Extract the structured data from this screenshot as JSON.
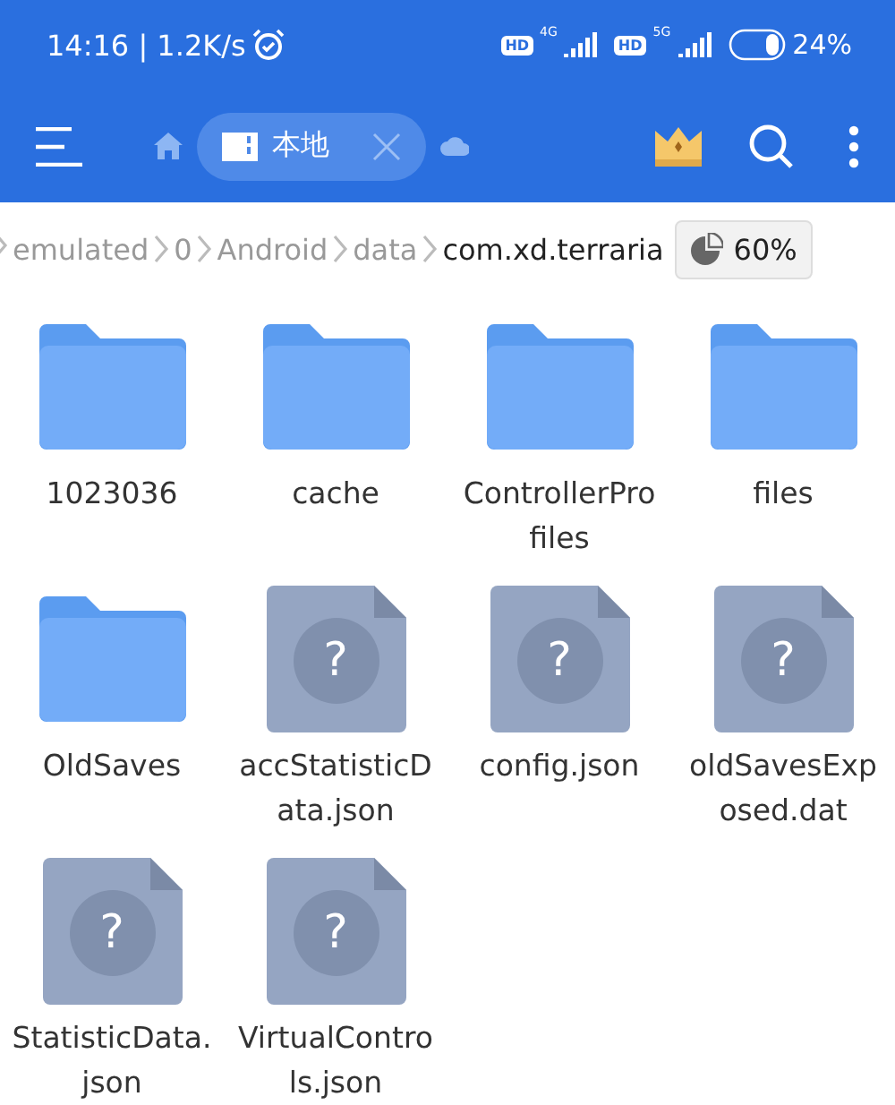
{
  "status_bar": {
    "time": "14:16 | 1.2K/s",
    "sims": [
      {
        "badge": "HD",
        "network": "4G"
      },
      {
        "badge": "HD",
        "network": "5G"
      }
    ],
    "battery": "24%"
  },
  "toolbar": {
    "tabs": [
      {
        "label": "本地",
        "selected": true
      }
    ]
  },
  "breadcrumb": {
    "items": [
      {
        "label": "emulated",
        "current": false
      },
      {
        "label": "0",
        "current": false
      },
      {
        "label": "Android",
        "current": false
      },
      {
        "label": "data",
        "current": false
      },
      {
        "label": "com.xd.terraria",
        "current": true
      }
    ],
    "storage": "60%"
  },
  "files": [
    {
      "name": "1023036",
      "kind": "folder"
    },
    {
      "name": "cache",
      "kind": "folder"
    },
    {
      "name": "ControllerProfiles",
      "kind": "folder"
    },
    {
      "name": "files",
      "kind": "folder"
    },
    {
      "name": "OldSaves",
      "kind": "folder"
    },
    {
      "name": "accStatisticData.json",
      "kind": "unknown",
      "glyph": "?"
    },
    {
      "name": "config.json",
      "kind": "unknown",
      "glyph": "?"
    },
    {
      "name": "oldSavesExposed.dat",
      "kind": "unknown",
      "glyph": "?"
    },
    {
      "name": "StatisticData.json",
      "kind": "unknown",
      "glyph": "?"
    },
    {
      "name": "VirtualControls.json",
      "kind": "unknown",
      "glyph": "?"
    }
  ]
}
